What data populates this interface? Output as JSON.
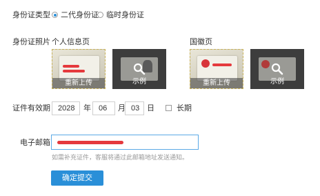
{
  "id_type": {
    "label": "身份证类型",
    "options": [
      {
        "label": "二代身份证",
        "selected": true
      },
      {
        "label": "临时身份证",
        "selected": false
      }
    ]
  },
  "id_photos": {
    "label": "身份证照片",
    "front": {
      "title": "个人信息页",
      "reupload": "重新上传",
      "example": "示例"
    },
    "back": {
      "title": "国徽页",
      "reupload": "重新上传",
      "example": "示例"
    }
  },
  "validity": {
    "label": "证件有效期",
    "year": "2028",
    "year_unit": "年",
    "month": "06",
    "month_unit": "月",
    "day": "03",
    "day_unit": "日",
    "long_term": {
      "label": "长期",
      "checked": false
    }
  },
  "email": {
    "label": "电子邮箱",
    "hint": "如需补充证件，客服将通过此邮箱地址发送通知。"
  },
  "submit_label": "确定提交",
  "colors": {
    "accent": "#2a8fd8",
    "focus_border": "#5aa9e6"
  }
}
